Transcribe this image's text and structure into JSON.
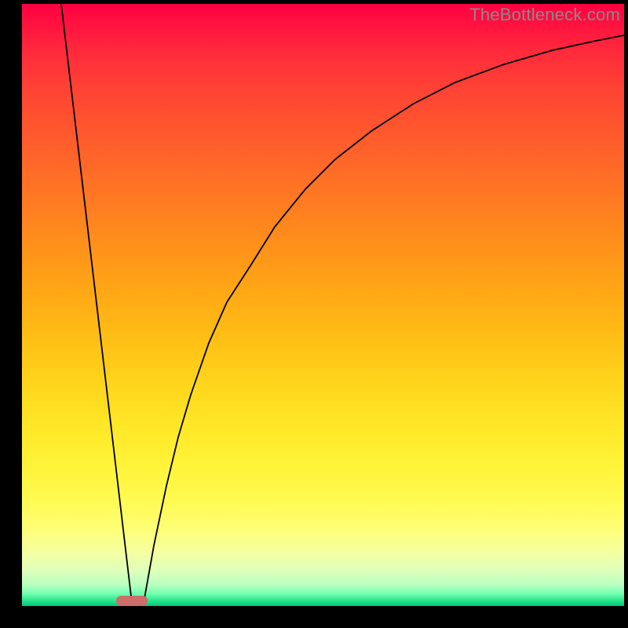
{
  "watermark": "TheBottleneck.com",
  "chart_data": {
    "type": "line",
    "title": "",
    "xlabel": "",
    "ylabel": "",
    "xlim": [
      0,
      100
    ],
    "ylim": [
      0,
      100
    ],
    "grid": false,
    "legend": false,
    "series": [
      {
        "name": "left-line",
        "x": [
          6.5,
          18.2
        ],
        "y": [
          100,
          0.5
        ]
      },
      {
        "name": "right-curve",
        "x": [
          20.2,
          22,
          24,
          26,
          28,
          31,
          34,
          38,
          42,
          47,
          52,
          58,
          65,
          72,
          80,
          88,
          96,
          100
        ],
        "y": [
          0.5,
          10,
          20,
          28,
          35,
          43,
          50,
          57,
          63,
          69,
          74,
          79,
          83.5,
          87,
          90,
          92.3,
          94,
          94.8
        ]
      }
    ],
    "marker": {
      "name": "highlight-bar",
      "x_range_pct": [
        15.6,
        20.8
      ],
      "color": "#cc6d6a"
    },
    "background_gradient": {
      "top": "#ff0040",
      "middle": "#ffe726",
      "bottom": "#00c878"
    }
  }
}
